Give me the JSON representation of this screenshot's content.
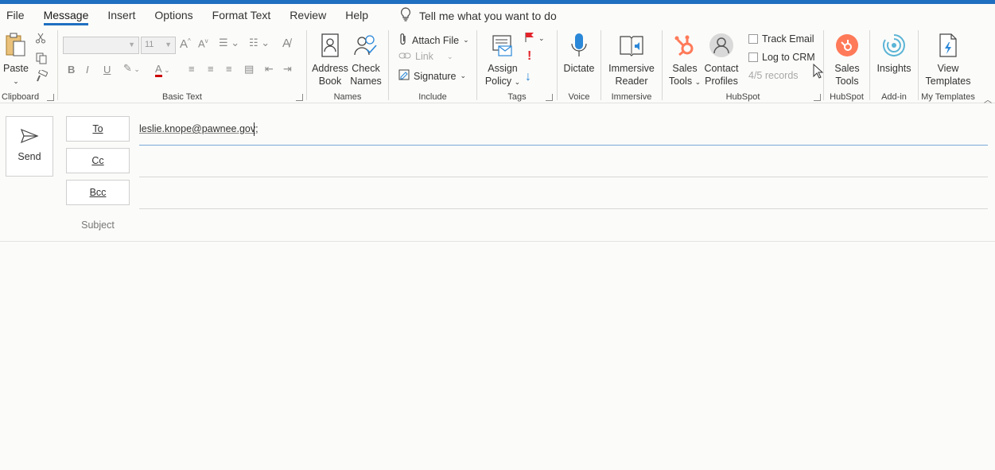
{
  "tabs": [
    "File",
    "Message",
    "Insert",
    "Options",
    "Format Text",
    "Review",
    "Help"
  ],
  "active_tab": "Message",
  "tell_me": "Tell me what you want to do",
  "ribbon": {
    "clipboard": {
      "paste": "Paste",
      "label": "Clipboard"
    },
    "basic_text": {
      "font_size": "11",
      "label": "Basic Text"
    },
    "names": {
      "address_book_1": "Address",
      "address_book_2": "Book",
      "check_names_1": "Check",
      "check_names_2": "Names",
      "label": "Names"
    },
    "include": {
      "attach_file": "Attach File",
      "link": "Link",
      "signature": "Signature",
      "label": "Include"
    },
    "tags": {
      "assign_policy_1": "Assign",
      "assign_policy_2": "Policy",
      "label": "Tags"
    },
    "voice": {
      "dictate": "Dictate",
      "label": "Voice"
    },
    "immersive": {
      "reader_1": "Immersive",
      "reader_2": "Reader",
      "label": "Immersive"
    },
    "hubspot": {
      "sales_tools_1": "Sales",
      "sales_tools_2": "Tools",
      "contact_profiles_1": "Contact",
      "contact_profiles_2": "Profiles",
      "track_email": "Track Email",
      "log_to_crm": "Log to CRM",
      "records": "4/5 records",
      "label": "HubSpot"
    },
    "hubspot2": {
      "sales_tools_1": "Sales",
      "sales_tools_2": "Tools",
      "label": "HubSpot"
    },
    "addin": {
      "insights": "Insights",
      "label": "Add-in"
    },
    "templates": {
      "view_1": "View",
      "view_2": "Templates",
      "label": "My Templates"
    }
  },
  "compose": {
    "send": "Send",
    "to": "To",
    "cc": "Cc",
    "bcc": "Bcc",
    "subject_placeholder": "Subject",
    "to_value": "leslie.knope@pawnee.gov;"
  },
  "colors": {
    "accent": "#1f6fc1",
    "hubspot_orange": "#ff7a59",
    "flag_red": "#e3242b"
  }
}
